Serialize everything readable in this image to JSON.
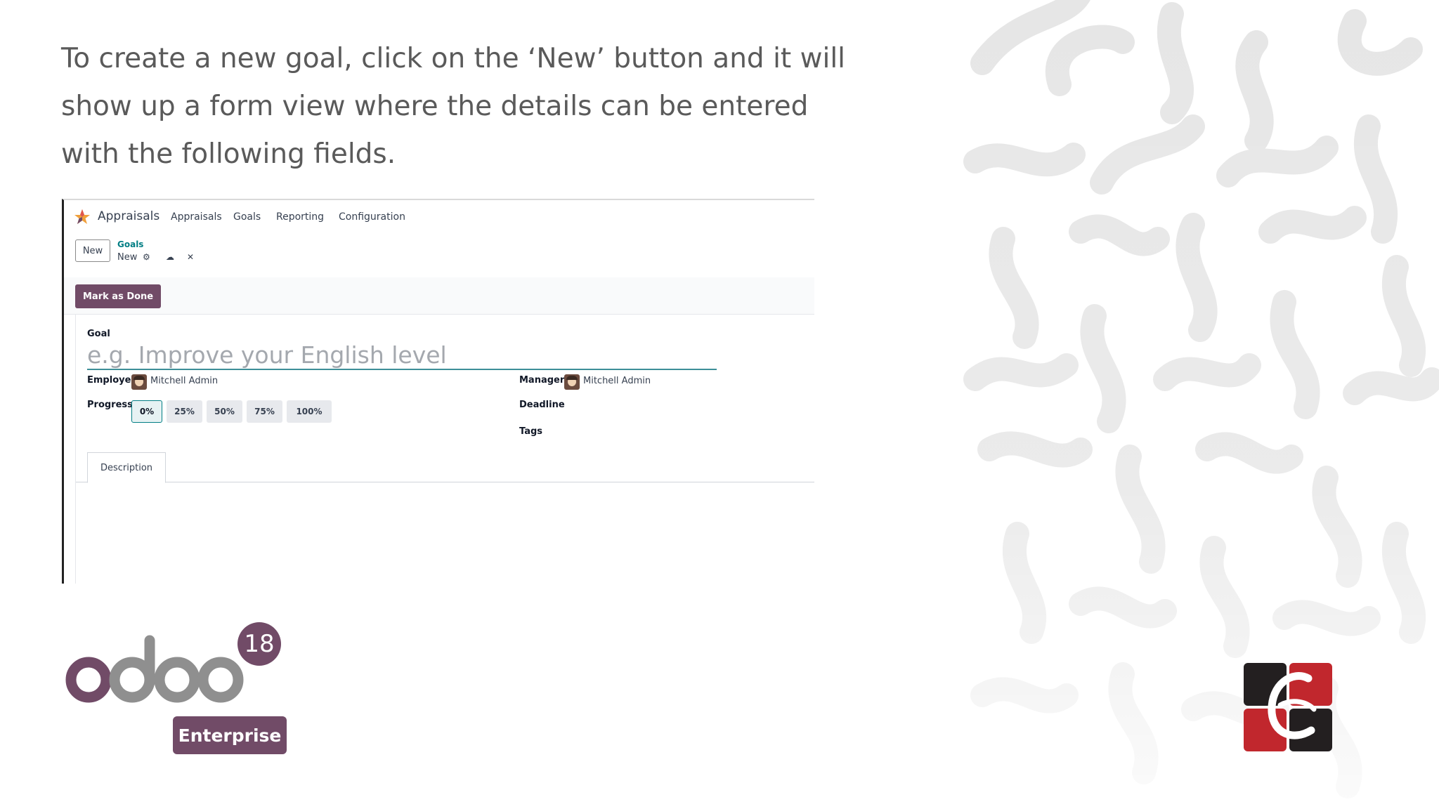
{
  "caption": "To create a new goal, click on the ‘New’ button and it will show up a form view where the details can be entered with the following fields.",
  "app": {
    "name": "Appraisals",
    "menu": [
      "Appraisals",
      "Goals",
      "Reporting",
      "Configuration"
    ]
  },
  "control_panel": {
    "new_label": "New",
    "breadcrumb_parent": "Goals",
    "breadcrumb_current": "New"
  },
  "status_bar": {
    "mark_done_label": "Mark as Done"
  },
  "form": {
    "goal_label": "Goal",
    "goal_placeholder": "e.g. Improve your English level",
    "employee_label": "Employee",
    "employee_value": "Mitchell Admin",
    "manager_label": "Manager",
    "manager_value": "Mitchell Admin",
    "progress_label": "Progress",
    "progress_options": [
      "0%",
      "25%",
      "50%",
      "75%",
      "100%"
    ],
    "progress_selected": "0%",
    "deadline_label": "Deadline",
    "tags_label": "Tags",
    "tab_description": "Description"
  },
  "logo": {
    "wordmark": "odoo",
    "version": "18",
    "edition": "Enterprise"
  },
  "colors": {
    "brand_purple": "#714b67",
    "teal": "#017e84",
    "brand_red": "#c1272d",
    "dark": "#231f20"
  }
}
